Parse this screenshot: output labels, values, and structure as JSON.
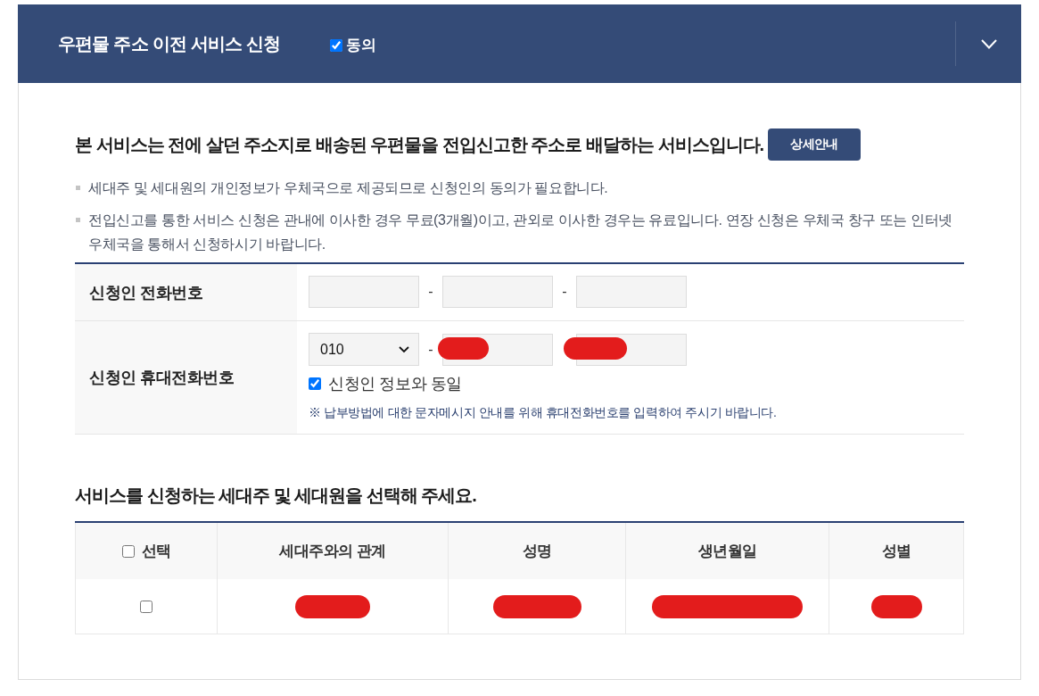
{
  "header": {
    "title": "우편물 주소 이전 서비스 신청",
    "agree": {
      "label": "동의",
      "checked": true
    },
    "expanded": true
  },
  "intro": {
    "headline": "본 서비스는 전에 살던 주소지로 배송된 우편물을 전입신고한 주소로 배달하는 서비스입니다.",
    "detail_button": "상세안내"
  },
  "notes": [
    "세대주 및 세대원의 개인정보가 우체국으로 제공되므로 신청인의 동의가 필요합니다.",
    "전입신고를 통한 서비스 신청은 관내에 이사한 경우 무료(3개월)이고, 관외로 이사한 경우는 유료입니다. 연장 신청은 우체국 창구 또는 인터넷 우체국을 통해서 신청하시기 바랍니다."
  ],
  "form": {
    "rows": [
      {
        "label": "신청인 전화번호",
        "parts": [
          {
            "kind": "input",
            "redacted": false
          },
          {
            "kind": "separator",
            "text": "-"
          },
          {
            "kind": "input",
            "redacted": false
          },
          {
            "kind": "separator",
            "text": "-"
          },
          {
            "kind": "input",
            "redacted": false
          }
        ]
      },
      {
        "label": "신청인 휴대전화번호",
        "parts": [
          {
            "kind": "select",
            "value": "010"
          },
          {
            "kind": "separator",
            "text": "-"
          },
          {
            "kind": "input",
            "redacted": true
          },
          {
            "kind": "separator"
          },
          {
            "kind": "input",
            "redacted": true
          }
        ],
        "same_as_applicant": {
          "label": "신청인 정보와 동일",
          "checked": true
        },
        "note": "※ 납부방법에 대한 문자메시지 안내를 위해 휴대전화번호를 입력하여 주시기 바랍니다."
      }
    ]
  },
  "household": {
    "heading": "서비스를 신청하는 세대주 및 세대원을 선택해 주세요.",
    "columns": [
      {
        "kind": "select",
        "label": "선택",
        "checked": false
      },
      {
        "kind": "text",
        "label": "세대주와의 관계"
      },
      {
        "kind": "text",
        "label": "성명"
      },
      {
        "kind": "text",
        "label": "생년월일"
      },
      {
        "kind": "text",
        "label": "성별"
      }
    ],
    "rows": [
      {
        "checked": false,
        "cells": [
          {
            "redacted": true
          },
          {
            "redacted": true
          },
          {
            "redacted": true
          },
          {
            "redacted": true
          }
        ]
      }
    ]
  }
}
